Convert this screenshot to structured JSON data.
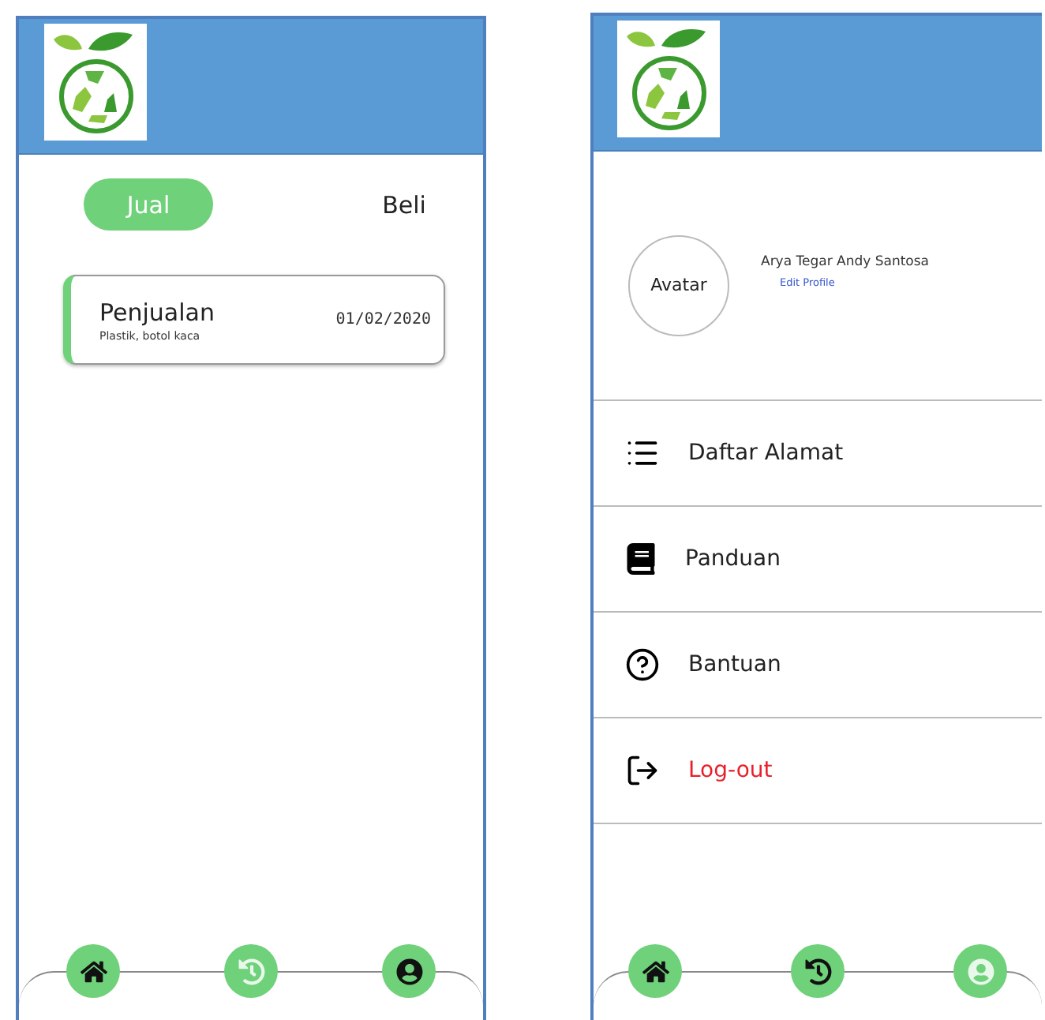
{
  "screens": [
    {
      "kind": "transactions",
      "tabs": [
        {
          "label": "Jual",
          "selected": true
        },
        {
          "label": "Beli",
          "selected": false
        }
      ],
      "transactions": [
        {
          "title": "Penjualan",
          "items": "Plastik, botol kaca",
          "date": "01/02/2020"
        }
      ],
      "nav": [
        {
          "kind": "home",
          "selected": false
        },
        {
          "kind": "history",
          "selected": true
        },
        {
          "kind": "profile",
          "selected": false
        }
      ]
    },
    {
      "kind": "profile",
      "profile": {
        "avatar_label": "Avatar",
        "name": "Arya Tegar Andy Santosa",
        "edit_link": "Edit Profile"
      },
      "menu": [
        {
          "kind": "list",
          "label": "Daftar Alamat"
        },
        {
          "kind": "guide",
          "label": "Panduan"
        },
        {
          "kind": "help",
          "label": "Bantuan"
        },
        {
          "kind": "logout",
          "label": "Log-out"
        }
      ],
      "nav": [
        {
          "kind": "home",
          "selected": false
        },
        {
          "kind": "history",
          "selected": false
        },
        {
          "kind": "profile",
          "selected": true
        }
      ]
    }
  ]
}
